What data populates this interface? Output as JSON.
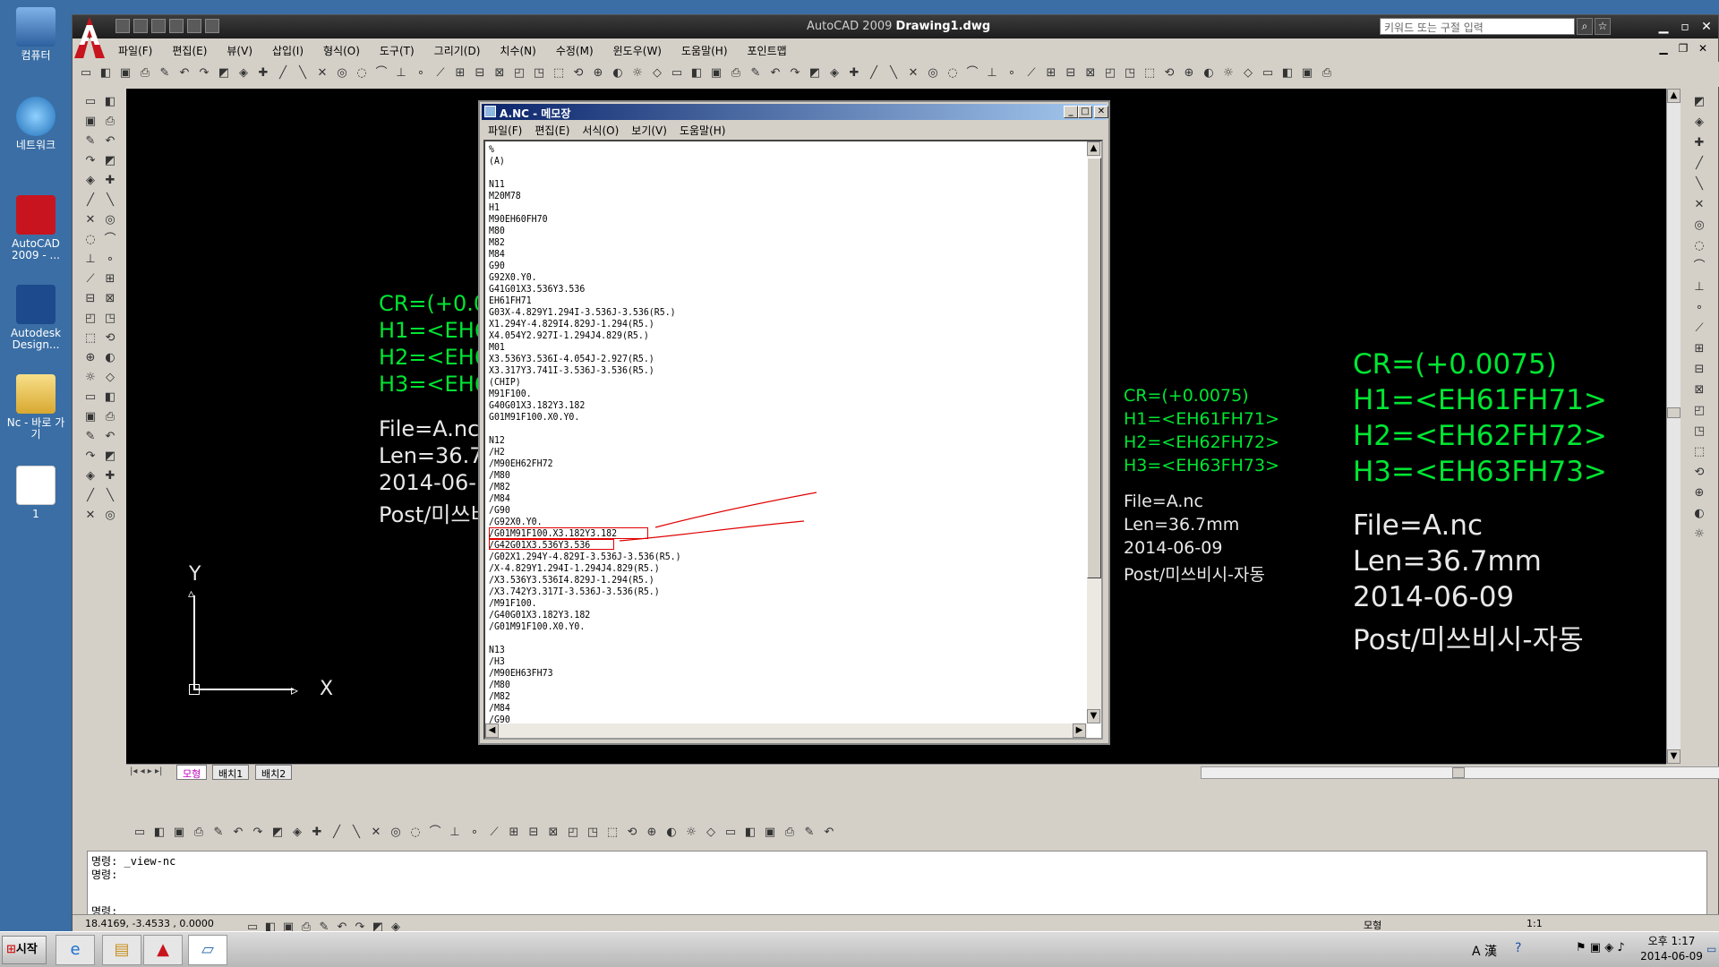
{
  "desktop": {
    "icons": [
      {
        "label": "컴퓨터"
      },
      {
        "label": "네트워크"
      },
      {
        "label": "AutoCAD 2009 - ..."
      },
      {
        "label": "Autodesk Design..."
      },
      {
        "label": "Nc - 바로 가기"
      },
      {
        "label": "1"
      }
    ]
  },
  "acad": {
    "title_app": "AutoCAD 2009",
    "title_doc": "Drawing1.dwg",
    "search_placeholder": "키워드 또는 구절 입력",
    "menu": [
      "파일(F)",
      "편집(E)",
      "뷰(V)",
      "삽입(I)",
      "형식(O)",
      "도구(T)",
      "그리기(D)",
      "치수(N)",
      "수정(M)",
      "윈도우(W)",
      "도움말(H)",
      "포인트맵"
    ],
    "tabs": [
      "모형",
      "배치1",
      "배치2"
    ],
    "command_lines": [
      "명령: _view-nc",
      "명령:",
      "명령:"
    ],
    "coords": "18.4169, -3.4533 , 0.0000",
    "status_model": "모형",
    "status_scale": "1:1"
  },
  "drawing": {
    "block_left": {
      "cr": "CR=(+0.0(",
      "h1": "H1=<EH61",
      "h2": "H2=<EH62",
      "h3": "H3=<EH63",
      "file": "File=A.nc",
      "len": "Len=36.7m",
      "date": "2014-06-",
      "post": "Post/미쓰비"
    },
    "block_mid": {
      "cr": "CR=(+0.0075)",
      "h1": "H1=<EH61FH71>",
      "h2": "H2=<EH62FH72>",
      "h3": "H3=<EH63FH73>",
      "file": "File=A.nc",
      "len": "Len=36.7mm",
      "date": "2014-06-09",
      "post": "Post/미쓰비시-자동"
    },
    "block_right": {
      "cr": "CR=(+0.0075)",
      "h1": "H1=<EH61FH71>",
      "h2": "H2=<EH62FH72>",
      "h3": "H3=<EH63FH73>",
      "file": "File=A.nc",
      "len": "Len=36.7mm",
      "date": "2014-06-09",
      "post": "Post/미쓰비시-자동"
    },
    "ucs_x": "X",
    "ucs_y": "Y"
  },
  "notepad": {
    "title": "A.NC - 메모장",
    "menu": [
      "파일(F)",
      "편집(E)",
      "서식(O)",
      "보기(V)",
      "도움말(H)"
    ],
    "text": "%\n(A)\n\nN11\nM20M78\nH1\nM90EH60FH70\nM80\nM82\nM84\nG90\nG92X0.Y0.\nG41G01X3.536Y3.536\nEH61FH71\nG03X-4.829Y1.294I-3.536J-3.536(R5.)\nX1.294Y-4.829I4.829J-1.294(R5.)\nX4.054Y2.927I-1.294J4.829(R5.)\nM01\nX3.536Y3.536I-4.054J-2.927(R5.)\nX3.317Y3.741I-3.536J-3.536(R5.)\n(CHIP)\nM91F100.\nG40G01X3.182Y3.182\nG01M91F100.X0.Y0.\n\nN12\n/H2\n/M90EH62FH72\n/M80\n/M82\n/M84\n/G90\n/G92X0.Y0.\n/G01M91F100.X3.182Y3.182\n/G42G01X3.536Y3.536\n/G02X1.294Y-4.829I-3.536J-3.536(R5.)\n/X-4.829Y1.294I-1.294J4.829(R5.)\n/X3.536Y3.536I4.829J-1.294(R5.)\n/X3.742Y3.317I-3.536J-3.536(R5.)\n/M91F100.\n/G40G01X3.182Y3.182\n/G01M91F100.X0.Y0.\n\nN13\n/H3\n/M90EH63FH73\n/M80\n/M82\n/M84\n/G90"
  },
  "taskbar": {
    "start": "시작",
    "ime": "A 漢",
    "time": "오후 1:17",
    "date": "2014-06-09"
  },
  "colors": {
    "drawing_bg": "#000000",
    "text_green": "#00e633",
    "title_blue": "#0a246a",
    "annotation_red": "#e00000"
  }
}
